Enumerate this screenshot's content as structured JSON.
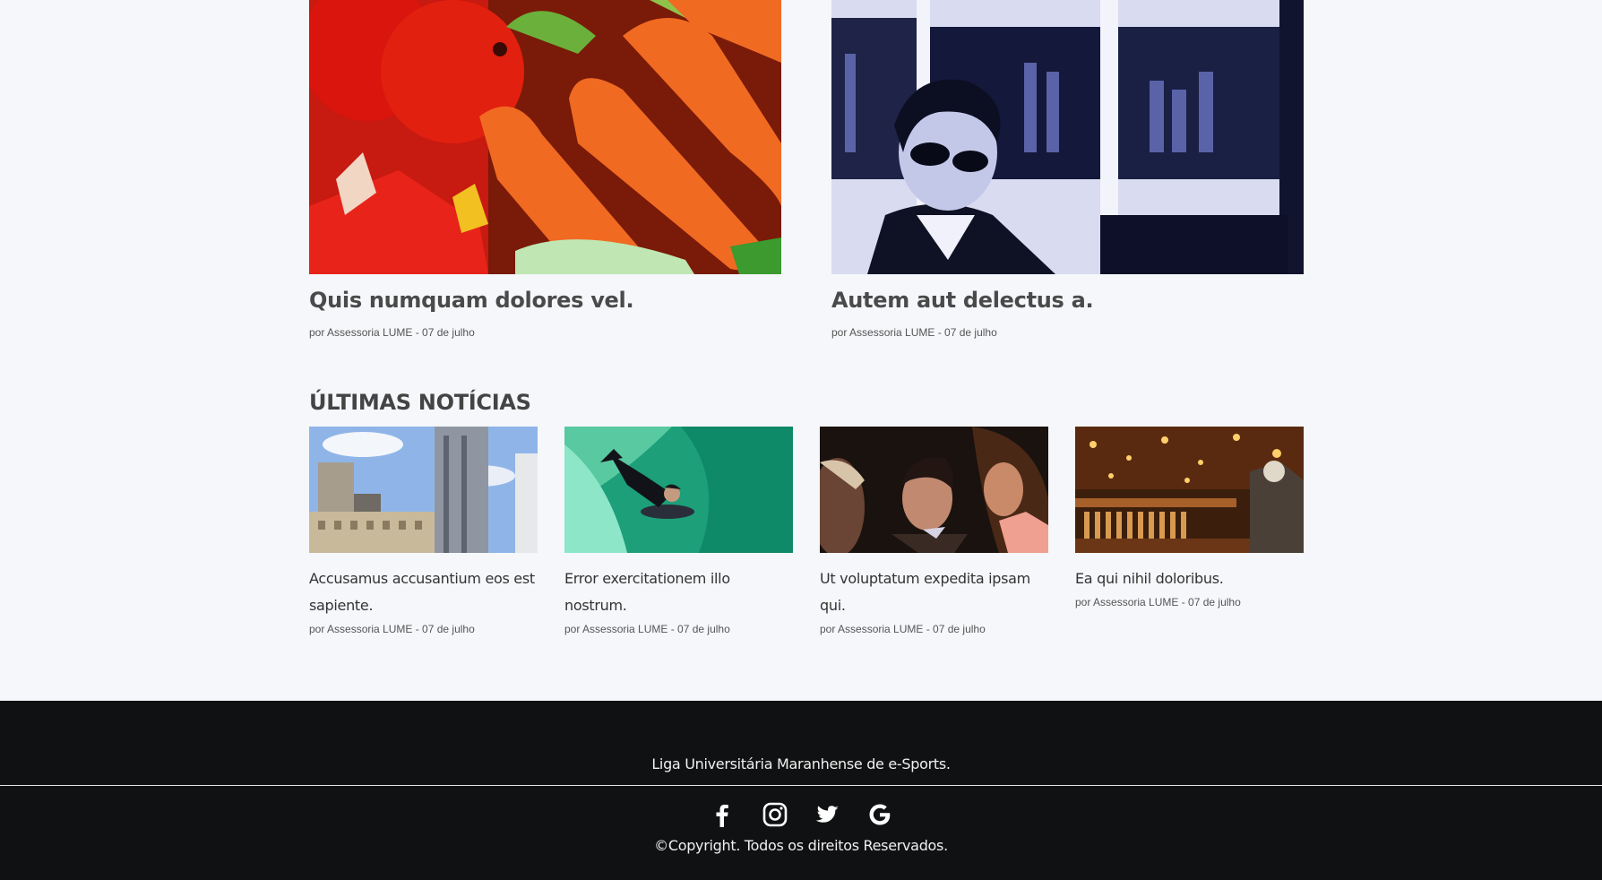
{
  "featured": [
    {
      "title": "Quis numquam dolores vel.",
      "meta": "por Assessoria LUME - 07 de julho",
      "image": "vegetables-photo"
    },
    {
      "title": "Autem aut delectus a.",
      "meta": "por Assessoria LUME - 07 de julho",
      "image": "man-sunglasses-bar-photo"
    }
  ],
  "latest": {
    "heading": "ÚLTIMAS NOTÍCIAS",
    "items": [
      {
        "title": "Accusamus accusantium eos est sapiente.",
        "meta": "por Assessoria LUME - 07 de julho",
        "image": "city-skyline-photo"
      },
      {
        "title": "Error exercitationem illo nostrum.",
        "meta": "por Assessoria LUME - 07 de julho",
        "image": "bodyboard-surfer-photo"
      },
      {
        "title": "Ut voluptatum expedita ipsam qui.",
        "meta": "por Assessoria LUME - 07 de julho",
        "image": "party-people-photo"
      },
      {
        "title": "Ea qui nihil doloribus.",
        "meta": "por Assessoria LUME - 07 de julho",
        "image": "pub-interior-photo"
      }
    ]
  },
  "footer": {
    "organization": "Liga Universitária Maranhense de e-Sports.",
    "copyright": "©Copyright. Todos os direitos Reservados.",
    "socials": [
      "facebook-icon",
      "instagram-icon",
      "twitter-icon",
      "google-icon"
    ]
  }
}
